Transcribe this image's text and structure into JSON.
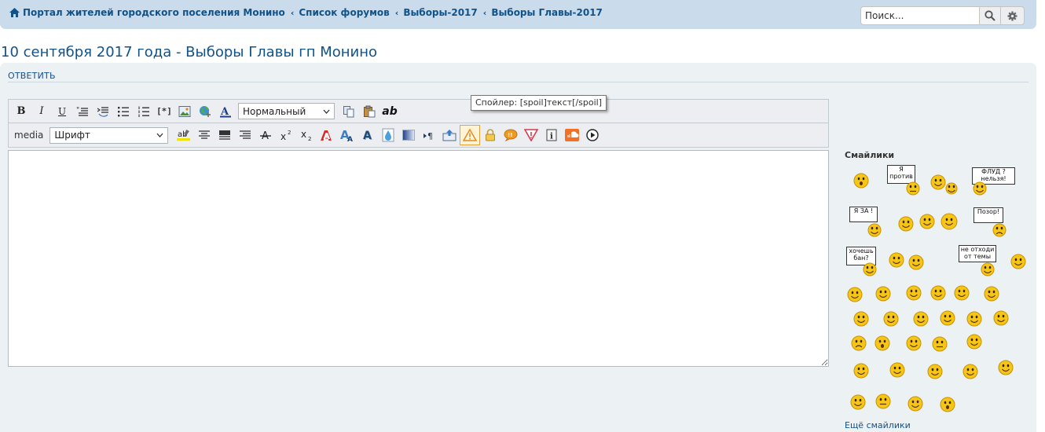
{
  "breadcrumbs": [
    {
      "label": "Портал жителей городского поселения Монино"
    },
    {
      "label": "Список форумов"
    },
    {
      "label": "Выборы-2017"
    },
    {
      "label": "Выборы Главы-2017"
    }
  ],
  "search": {
    "placeholder": "Поиск..."
  },
  "page": {
    "title": "10 сентября 2017 года - Выборы Главы гп Монино"
  },
  "post": {
    "reply_label": "ОТВЕТИТЬ"
  },
  "editor": {
    "format_select": "Нормальный",
    "font_select": "Шрифт",
    "media_label": "media",
    "bold": "B",
    "italic": "I",
    "underline": "U",
    "code_label": "[*]",
    "ab_label": "ab",
    "tooltip": "Спойлер: [spoil]текст[/spoil]"
  },
  "smilies": {
    "title": "Смайлики",
    "more": "Ещё смайлики",
    "sign_protiv": "Я против",
    "sign_flud": "ФЛУД ? нельзя!",
    "sign_za": "Я ЗА !",
    "sign_pozor": "Позор!",
    "sign_ban": "хочешь бан?",
    "sign_tema": "не отходи от темы"
  }
}
